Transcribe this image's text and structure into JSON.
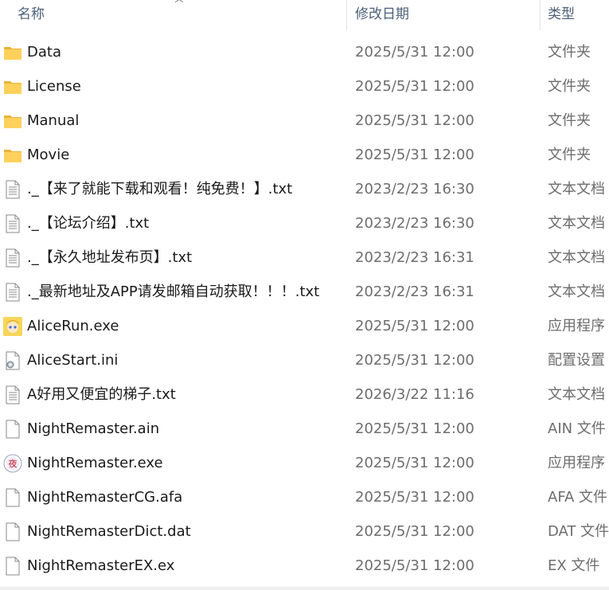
{
  "columns": {
    "name": "名称",
    "date": "修改日期",
    "type": "类型"
  },
  "files": [
    {
      "name": "Data",
      "date": "2025/5/31 12:00",
      "type": "文件夹",
      "icon": "folder-icon"
    },
    {
      "name": "License",
      "date": "2025/5/31 12:00",
      "type": "文件夹",
      "icon": "folder-icon"
    },
    {
      "name": "Manual",
      "date": "2025/5/31 12:00",
      "type": "文件夹",
      "icon": "folder-icon"
    },
    {
      "name": "Movie",
      "date": "2025/5/31 12:00",
      "type": "文件夹",
      "icon": "folder-icon"
    },
    {
      "name": "._【来了就能下载和观看！纯免费！】.txt",
      "date": "2023/2/23 16:30",
      "type": "文本文档",
      "icon": "text-file-icon"
    },
    {
      "name": "._【论坛介绍】.txt",
      "date": "2023/2/23 16:30",
      "type": "文本文档",
      "icon": "text-file-icon"
    },
    {
      "name": "._【永久地址发布页】.txt",
      "date": "2023/2/23 16:31",
      "type": "文本文档",
      "icon": "text-file-icon"
    },
    {
      "name": "._最新地址及APP请发邮箱自动获取！！！.txt",
      "date": "2023/2/23 16:31",
      "type": "文本文档",
      "icon": "text-file-icon"
    },
    {
      "name": "AliceRun.exe",
      "date": "2025/5/31 12:00",
      "type": "应用程序",
      "icon": "app-character-icon"
    },
    {
      "name": "AliceStart.ini",
      "date": "2025/5/31 12:00",
      "type": "配置设置",
      "icon": "config-file-icon"
    },
    {
      "name": "A好用又便宜的梯子.txt",
      "date": "2026/3/22 11:16",
      "type": "文本文档",
      "icon": "text-file-icon"
    },
    {
      "name": "NightRemaster.ain",
      "date": "2025/5/31 12:00",
      "type": "AIN 文件",
      "icon": "blank-file-icon"
    },
    {
      "name": "NightRemaster.exe",
      "date": "2025/5/31 12:00",
      "type": "应用程序",
      "icon": "app-badge-icon"
    },
    {
      "name": "NightRemasterCG.afa",
      "date": "2025/5/31 12:00",
      "type": "AFA 文件",
      "icon": "blank-file-icon"
    },
    {
      "name": "NightRemasterDict.dat",
      "date": "2025/5/31 12:00",
      "type": "DAT 文件",
      "icon": "blank-file-icon"
    },
    {
      "name": "NightRemasterEX.ex",
      "date": "2025/5/31 12:00",
      "type": "EX 文件",
      "icon": "blank-file-icon"
    }
  ]
}
